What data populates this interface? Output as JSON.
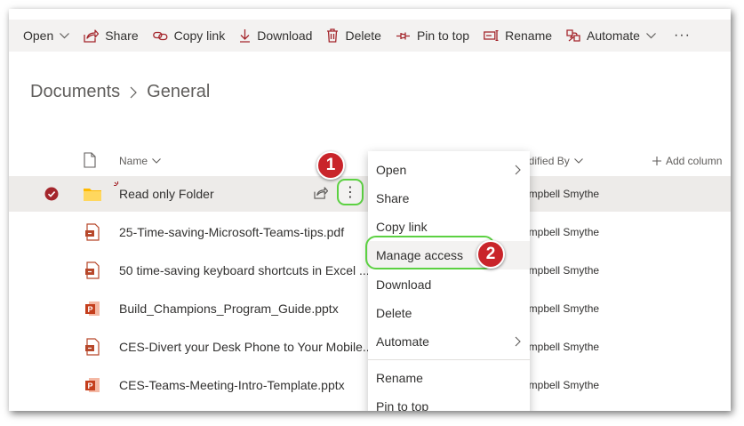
{
  "commandbar": {
    "open": "Open",
    "share": "Share",
    "copy_link": "Copy link",
    "download": "Download",
    "delete": "Delete",
    "pin_to_top": "Pin to top",
    "rename": "Rename",
    "automate": "Automate",
    "more": "···"
  },
  "breadcrumb": {
    "root": "Documents",
    "current": "General"
  },
  "list": {
    "header": {
      "name": "Name",
      "modified_by": "odified By",
      "add_column": "Add column"
    },
    "rows": [
      {
        "name": "Read only Folder",
        "modified_by": "ampbell Smythe",
        "type": "folder"
      },
      {
        "name": "25-Time-saving-Microsoft-Teams-tips.pdf",
        "modified_by": "ampbell Smythe",
        "type": "pdf"
      },
      {
        "name": "50 time-saving keyboard shortcuts in Excel ...",
        "modified_by": "ampbell Smythe",
        "type": "pdf"
      },
      {
        "name": "Build_Champions_Program_Guide.pptx",
        "modified_by": "ampbell Smythe",
        "type": "pptx"
      },
      {
        "name": "CES-Divert your Desk Phone to Your Mobile....",
        "modified_by": "ampbell Smythe",
        "type": "pdf"
      },
      {
        "name": "CES-Teams-Meeting-Intro-Template.pptx",
        "modified_by": "ampbell Smythe",
        "type": "pptx"
      }
    ],
    "row_more": "⋮"
  },
  "context_menu": {
    "items": [
      {
        "label": "Open",
        "submenu": true
      },
      {
        "label": "Share"
      },
      {
        "label": "Copy link"
      },
      {
        "label": "Manage access"
      },
      {
        "label": "Download"
      },
      {
        "label": "Delete"
      },
      {
        "label": "Automate",
        "submenu": true
      },
      {
        "label": "Rename"
      },
      {
        "label": "Pin to top"
      }
    ]
  },
  "annotations": {
    "step1": "1",
    "step2": "2"
  },
  "colors": {
    "brand_red": "#a4262c",
    "pdf_red": "#b7472a",
    "folder_yellow": "#ffb900",
    "highlight_green": "#5cd142",
    "badge_red": "#c9242a"
  }
}
